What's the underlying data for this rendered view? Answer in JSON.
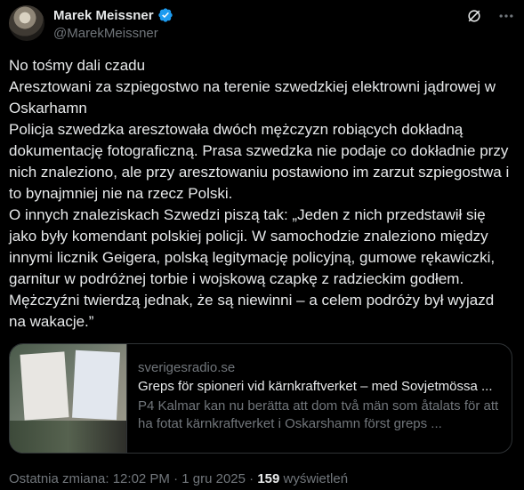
{
  "author": {
    "name": "Marek Meissner",
    "handle": "@MarekMeissner",
    "verified_icon": "verified-badge-icon",
    "verified_color": "#1d9bf0"
  },
  "top_icons": [
    "grok-icon",
    "more-icon"
  ],
  "tweet_lines": [
    "No tośmy dali czadu",
    "Aresztowani za szpiegostwo na terenie szwedzkiej elektrowni jądrowej w Oskarhamn",
    "Policja szwedzka aresztowała dwóch mężczyzn robiących dokładną dokumentację fotograficzną. Prasa szwedzka nie podaje co dokładnie przy nich znaleziono, ale przy aresztowaniu postawiono im zarzut szpiegostwa i to bynajmniej nie na rzecz Polski.",
    "O innych znaleziskach Szwedzi piszą tak: „Jeden z nich przedstawił się jako były komendant polskiej policji. W samochodzie znaleziono między innymi licznik Geigera, polską legitymację policyjną, gumowe rękawiczki, garnitur w podróżnej torbie i wojskową czapkę z radzieckim godłem. Mężczyźni twierdzą jednak, że są niewinni – a celem podróży był wyjazd na wakacje.”"
  ],
  "link_card": {
    "domain": "sverigesradio.se",
    "title": "Greps för spioneri vid kärnkraftverket – med Sovjetmössa ...",
    "description": "P4 Kalmar kan nu berätta att dom två män som åtalats för att ha fotat kärnkraftverket i Oskarshamn först greps ..."
  },
  "meta": {
    "edited": "Ostatnia zmiana: 12:02 PM · 1 gru 2025 · ",
    "views_count": "159",
    "views_label": " wyświetleń"
  }
}
